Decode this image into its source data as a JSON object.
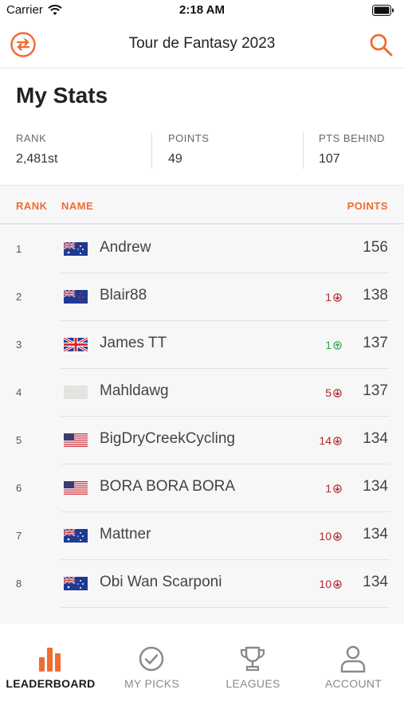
{
  "status_bar": {
    "carrier": "Carrier",
    "time": "2:18 AM"
  },
  "nav": {
    "title": "Tour de Fantasy 2023",
    "left_icon": "swap-icon",
    "right_icon": "search-icon"
  },
  "page_title": "My Stats",
  "stats": [
    {
      "label": "RANK",
      "value": "2,481st"
    },
    {
      "label": "POINTS",
      "value": "49"
    },
    {
      "label": "PTS BEHIND",
      "value": "107"
    }
  ],
  "table": {
    "headers": {
      "rank": "RANK",
      "name": "NAME",
      "points": "POINTS"
    },
    "rows": [
      {
        "rank": "1",
        "flag": "au",
        "name": "Andrew",
        "movement": "",
        "direction": "",
        "points": "156"
      },
      {
        "rank": "2",
        "flag": "nz",
        "name": "Blair88",
        "movement": "1",
        "direction": "down",
        "points": "138"
      },
      {
        "rank": "3",
        "flag": "gb",
        "name": "James TT",
        "movement": "1",
        "direction": "up",
        "points": "137"
      },
      {
        "rank": "4",
        "flag": "none",
        "name": "Mahldawg",
        "movement": "5",
        "direction": "down",
        "points": "137"
      },
      {
        "rank": "5",
        "flag": "us",
        "name": "BigDryCreekCycling",
        "movement": "14",
        "direction": "down",
        "points": "134"
      },
      {
        "rank": "6",
        "flag": "us",
        "name": "BORA BORA BORA",
        "movement": "1",
        "direction": "down",
        "points": "134"
      },
      {
        "rank": "7",
        "flag": "au",
        "name": "Mattner",
        "movement": "10",
        "direction": "down",
        "points": "134"
      },
      {
        "rank": "8",
        "flag": "au",
        "name": "Obi Wan Scarponi",
        "movement": "10",
        "direction": "down",
        "points": "134"
      }
    ]
  },
  "tabs": [
    {
      "label": "LEADERBOARD",
      "icon": "bar-chart-icon",
      "active": true
    },
    {
      "label": "MY PICKS",
      "icon": "check-circle-icon",
      "active": false
    },
    {
      "label": "LEAGUES",
      "icon": "trophy-icon",
      "active": false
    },
    {
      "label": "ACCOUNT",
      "icon": "person-icon",
      "active": false
    }
  ],
  "colors": {
    "accent": "#ef6c33",
    "down": "#b3262d",
    "up": "#2aa84a"
  }
}
